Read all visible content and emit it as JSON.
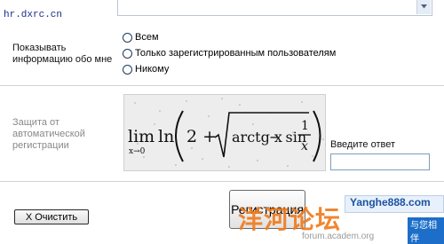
{
  "page": {
    "url_text": "hr.dxrc.cn"
  },
  "privacy": {
    "label_line1": "Показывать",
    "label_line2": "информацию обо мне",
    "options": [
      {
        "label": "Всем",
        "selected": false
      },
      {
        "label": "Только зарегистрированным пользователям",
        "selected": false
      },
      {
        "label": "Никому",
        "selected": false
      }
    ]
  },
  "captcha": {
    "label_line1": "Защита от",
    "label_line2": "автоматической",
    "label_line3": "регистрации",
    "formula_lim": "lim",
    "formula_sub": "x→0",
    "formula_ln": "ln",
    "formula_two_plus": "2 +",
    "formula_arctg": "arctg x",
    "formula_minus_sin": "− sin",
    "formula_num": "1",
    "formula_den": "x",
    "answer_label": "Введите ответ",
    "answer_value": ""
  },
  "buttons": {
    "clear_label": "X  Очистить",
    "submit_label": "Регистрация"
  },
  "watermark": {
    "site": "Yanghe888.com",
    "chinese": "洋河论坛",
    "tag": "与您相伴",
    "forum": "forum.academ.org"
  },
  "colors": {
    "divider": "#d3d3d3",
    "url": "#1a2a8a",
    "label_gray": "#888888",
    "watermark_orange": "#f07a1a",
    "watermark_blue": "#1c53a0"
  }
}
